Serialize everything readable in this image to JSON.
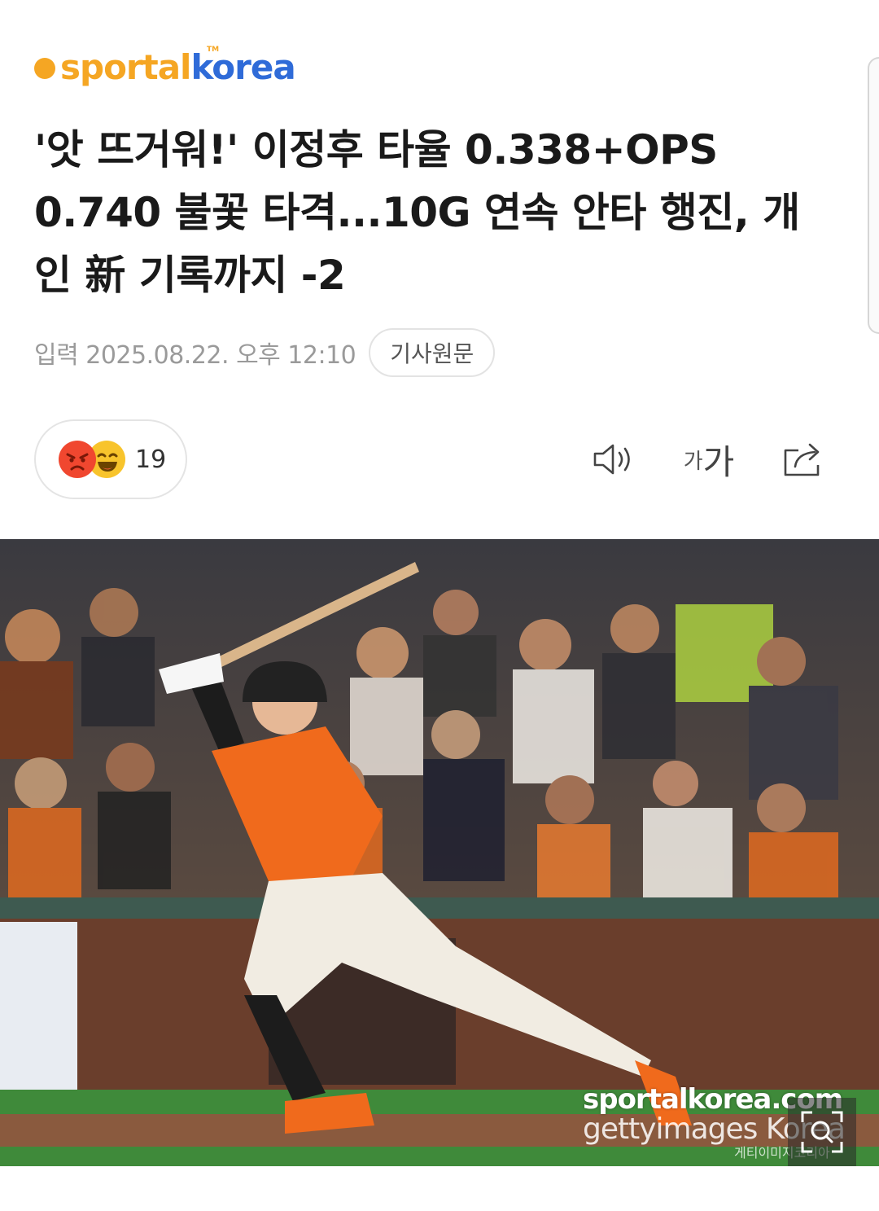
{
  "header": {
    "logo_part1": "sport",
    "logo_part2": "al",
    "logo_part3": "korea",
    "logo_tm": "TM"
  },
  "article": {
    "headline": "'앗 뜨거워!' 이정후 타율 0.338+OPS 0.740 불꽃 타격...10G 연속 안타 행진, 개인 新 기록까지 -2",
    "published": "입력 2025.08.22. 오후 12:10",
    "original_button": "기사원문"
  },
  "reactions": {
    "count": "19",
    "icons": [
      "angry-emoji-icon",
      "laughing-emoji-icon"
    ]
  },
  "toolbar": {
    "font_small": "가",
    "font_large": "가",
    "icons": [
      "speaker-icon",
      "font-size-icon",
      "share-icon"
    ]
  },
  "photo": {
    "watermark_site": "sportalkorea.com",
    "watermark_getty": "gettyimages Korea",
    "watermark_kr": "게티이미지코리아",
    "zoom_icon": "zoom-icon"
  },
  "colors": {
    "brand_orange": "#f5a623",
    "brand_blue": "#2f6bd8",
    "meta_gray": "#9a9a9a"
  }
}
